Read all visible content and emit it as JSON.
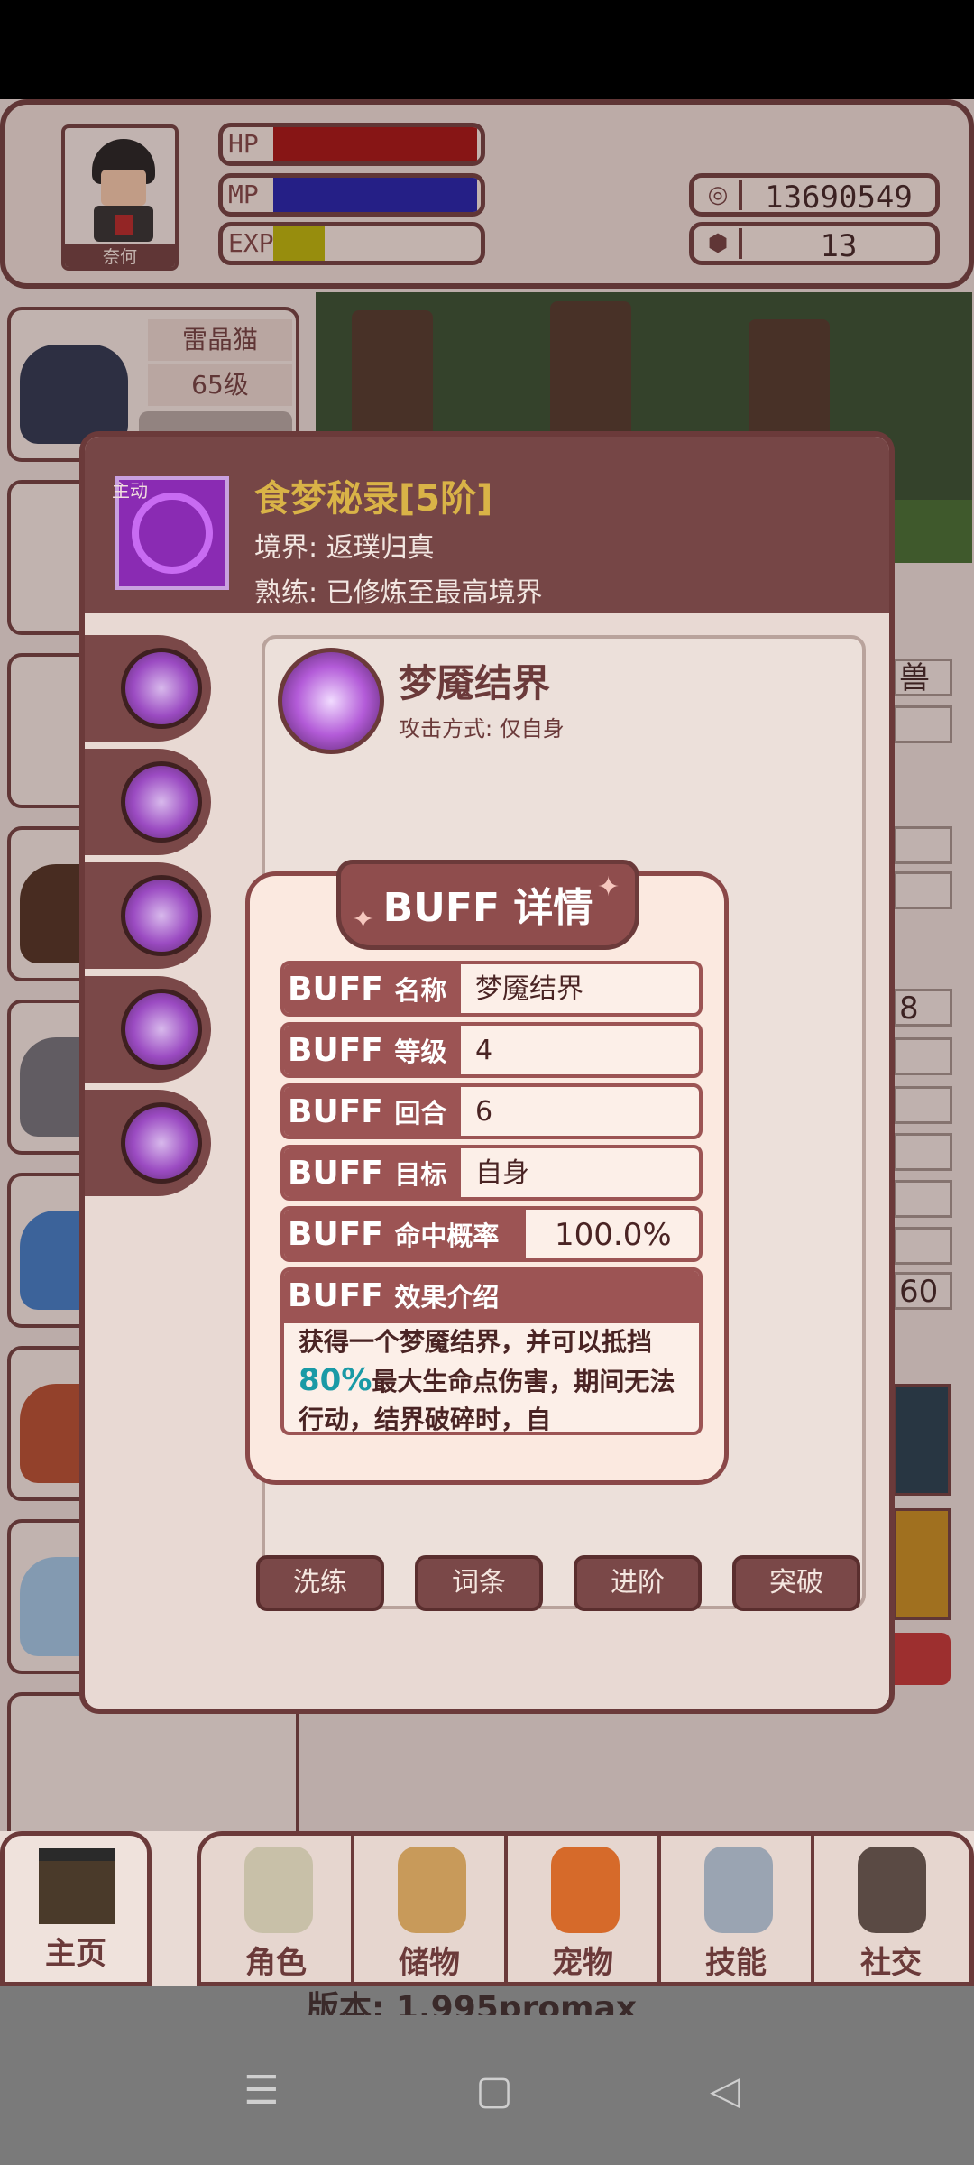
{
  "header": {
    "avatar_name": "奈何",
    "hp_label": "HP",
    "mp_label": "MP",
    "exp_label": "EXP",
    "exp_fraction": 0.25,
    "gold_value": "13690549",
    "gem_value": "13",
    "colors": {
      "hp": "#a10c0c",
      "mp": "#1a1aa8",
      "exp": "#b7b200"
    }
  },
  "pets": [
    {
      "name": "雷晶猫",
      "level": "65级",
      "color": "#24304a"
    }
  ],
  "skill": {
    "tag": "主动",
    "name": "食梦秘录[5阶]",
    "realm": "境界: 返璞归真",
    "mastery": "熟练: 已修炼至最高境界",
    "sub_name": "梦魇结界",
    "attack_mode": "攻击方式: 仅自身",
    "actions": [
      "洗练",
      "词条",
      "进阶",
      "突破"
    ]
  },
  "buff": {
    "title": "BUFF 详情",
    "rows": [
      {
        "key_a": "BUFF",
        "key_b": "名称",
        "value": "梦魇结界"
      },
      {
        "key_a": "BUFF",
        "key_b": "等级",
        "value": "4"
      },
      {
        "key_a": "BUFF",
        "key_b": "回合",
        "value": "6"
      },
      {
        "key_a": "BUFF",
        "key_b": "目标",
        "value": "自身"
      },
      {
        "key_a": "BUFF",
        "key_b": "命中概率",
        "value": "100.0%"
      }
    ],
    "effect_head_a": "BUFF",
    "effect_head_b": "效果介绍",
    "effect_text_1": "获得一个梦魇结界，并可以抵挡",
    "effect_highlight": "80%",
    "effect_text_2": "最大生命点伤害，期间无法行动，结界破碎时，自"
  },
  "nav": {
    "home": "主页",
    "items": [
      "角色",
      "储物",
      "宠物",
      "技能",
      "社交"
    ]
  },
  "version": "版本: 1.995promax",
  "side_values": [
    "兽",
    "8",
    "60"
  ]
}
